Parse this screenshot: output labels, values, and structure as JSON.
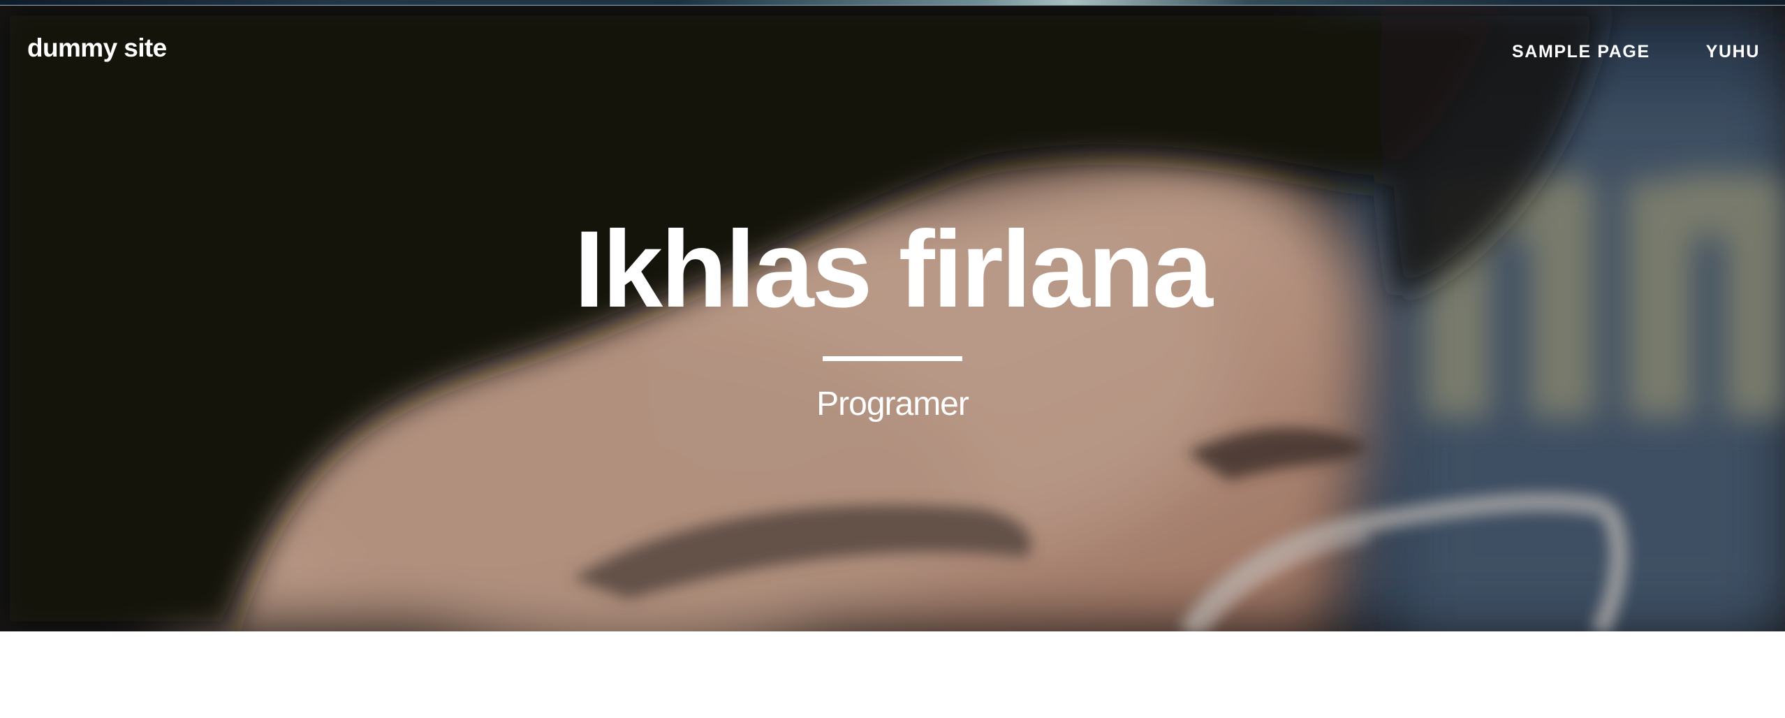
{
  "header": {
    "site_title": "dummy site",
    "nav": [
      {
        "label": "SAMPLE PAGE"
      },
      {
        "label": "YUHU"
      }
    ]
  },
  "hero": {
    "heading": "Ikhlas firlana",
    "subtitle": "Programer",
    "background_image": "blurred close-up photo of a face with glasses"
  },
  "colors": {
    "hero_text": "#ffffff",
    "page_background": "#ffffff"
  }
}
